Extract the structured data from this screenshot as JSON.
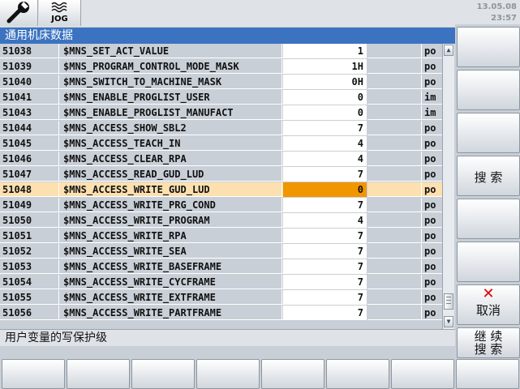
{
  "header": {
    "mode_label": "JOG",
    "date": "13.05.08",
    "time": "23:57"
  },
  "title": "通用机床数据",
  "table": {
    "rows": [
      {
        "id": "51038",
        "name": "$MNS_SET_ACT_VALUE",
        "value": "1",
        "unit": "po"
      },
      {
        "id": "51039",
        "name": "$MNS_PROGRAM_CONTROL_MODE_MASK",
        "value": "1H",
        "unit": "po"
      },
      {
        "id": "51040",
        "name": "$MNS_SWITCH_TO_MACHINE_MASK",
        "value": "0H",
        "unit": "po"
      },
      {
        "id": "51041",
        "name": "$MNS_ENABLE_PROGLIST_USER",
        "value": "0",
        "unit": "im"
      },
      {
        "id": "51043",
        "name": "$MNS_ENABLE_PROGLIST_MANUFACT",
        "value": "0",
        "unit": "im"
      },
      {
        "id": "51044",
        "name": "$MNS_ACCESS_SHOW_SBL2",
        "value": "7",
        "unit": "po"
      },
      {
        "id": "51045",
        "name": "$MNS_ACCESS_TEACH_IN",
        "value": "4",
        "unit": "po"
      },
      {
        "id": "51046",
        "name": "$MNS_ACCESS_CLEAR_RPA",
        "value": "4",
        "unit": "po"
      },
      {
        "id": "51047",
        "name": "$MNS_ACCESS_READ_GUD_LUD",
        "value": "7",
        "unit": "po"
      },
      {
        "id": "51048",
        "name": "$MNS_ACCESS_WRITE_GUD_LUD",
        "value": "0",
        "unit": "po"
      },
      {
        "id": "51049",
        "name": "$MNS_ACCESS_WRITE_PRG_COND",
        "value": "7",
        "unit": "po"
      },
      {
        "id": "51050",
        "name": "$MNS_ACCESS_WRITE_PROGRAM",
        "value": "4",
        "unit": "po"
      },
      {
        "id": "51051",
        "name": "$MNS_ACCESS_WRITE_RPA",
        "value": "7",
        "unit": "po"
      },
      {
        "id": "51052",
        "name": "$MNS_ACCESS_WRITE_SEA",
        "value": "7",
        "unit": "po"
      },
      {
        "id": "51053",
        "name": "$MNS_ACCESS_WRITE_BASEFRAME",
        "value": "7",
        "unit": "po"
      },
      {
        "id": "51054",
        "name": "$MNS_ACCESS_WRITE_CYCFRAME",
        "value": "7",
        "unit": "po"
      },
      {
        "id": "51055",
        "name": "$MNS_ACCESS_WRITE_EXTFRAME",
        "value": "7",
        "unit": "po"
      },
      {
        "id": "51056",
        "name": "$MNS_ACCESS_WRITE_PARTFRAME",
        "value": "7",
        "unit": "po"
      }
    ],
    "selected_index": 9
  },
  "status_text": "用户变量的写保护级",
  "softkeys": {
    "search": "搜 索",
    "cancel": "取消",
    "continue_line1": "继 续",
    "continue_line2": "搜 索"
  },
  "colors": {
    "title_bar": "#3b73c0",
    "selected_row": "#fce0b0",
    "selected_value": "#f29600",
    "cancel_icon": "#e00000"
  }
}
